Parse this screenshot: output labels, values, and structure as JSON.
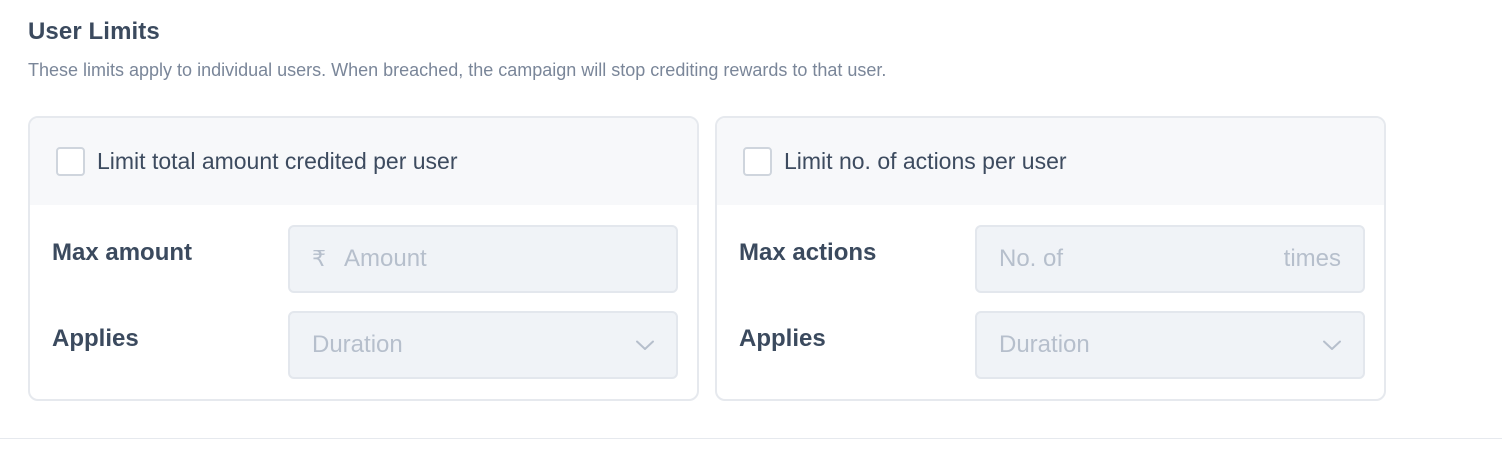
{
  "section": {
    "title": "User Limits",
    "subtitle": "These limits apply to individual users. When breached, the campaign will stop crediting rewards to that user."
  },
  "cards": [
    {
      "checkbox_label": "Limit total amount credited per user",
      "checked": false,
      "max_label": "Max amount",
      "max_prefix": "₹",
      "max_placeholder": "Amount",
      "max_suffix": "",
      "applies_label": "Applies",
      "applies_placeholder": "Duration"
    },
    {
      "checkbox_label": "Limit no. of actions per user",
      "checked": false,
      "max_label": "Max actions",
      "max_prefix": "",
      "max_placeholder": "No. of",
      "max_suffix": "times",
      "applies_label": "Applies",
      "applies_placeholder": "Duration"
    }
  ],
  "icons": {
    "dropdown": "chevron-down-icon",
    "currency": "rupee-icon"
  },
  "colors": {
    "card_header_bg": "#f7f8fa",
    "field_bg": "#f0f3f7",
    "border": "#e6e9ee",
    "heading_text": "#3b4a5e",
    "muted_text": "#7a8699",
    "placeholder_text": "#b6bfcc"
  }
}
